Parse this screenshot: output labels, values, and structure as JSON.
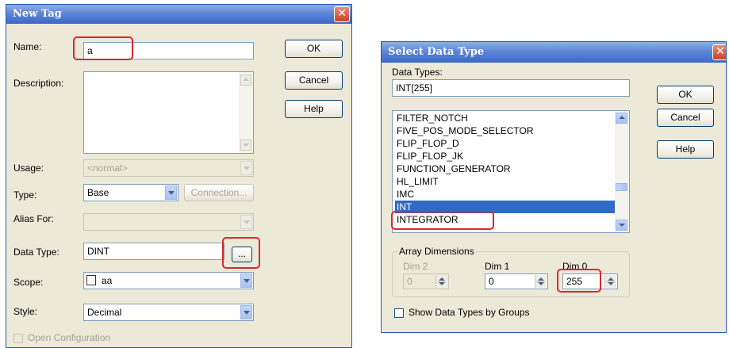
{
  "new_tag": {
    "title": "New Tag",
    "close_glyph": "✕",
    "name_label": "Name:",
    "name_value": "a",
    "description_label": "Description:",
    "usage_label": "Usage:",
    "usage_value": "<normal>",
    "type_label": "Type:",
    "type_value": "Base",
    "connection_button": "Connection...",
    "alias_label": "Alias For:",
    "data_type_label": "Data Type:",
    "data_type_value": "DINT",
    "browse_button": "...",
    "scope_label": "Scope:",
    "scope_value": "aa",
    "style_label": "Style:",
    "style_value": "Decimal",
    "open_config_label": "Open Configuration",
    "ok": "OK",
    "cancel": "Cancel",
    "help": "Help"
  },
  "select_data_type": {
    "title": "Select Data Type",
    "close_glyph": "✕",
    "data_types_label": "Data Types:",
    "data_types_value": "INT[255]",
    "list_items": [
      "FILTER_NOTCH",
      "FIVE_POS_MODE_SELECTOR",
      "FLIP_FLOP_D",
      "FLIP_FLOP_JK",
      "FUNCTION_GENERATOR",
      "HL_LIMIT",
      "IMC",
      "INT",
      "INTEGRATOR"
    ],
    "selected_item": "INT",
    "array_dimensions_label": "Array Dimensions",
    "dim2_label": "Dim 2",
    "dim2_value": "0",
    "dim1_label": "Dim 1",
    "dim1_value": "0",
    "dim0_label": "Dim 0",
    "dim0_value": "255",
    "show_by_groups_label": "Show Data Types by Groups",
    "ok": "OK",
    "cancel": "Cancel",
    "help": "Help"
  },
  "colors": {
    "titlebar": "#3a68c8",
    "dialog_bg": "#ece9d8",
    "selection": "#316ac5",
    "highlight_box": "#e0262b"
  }
}
